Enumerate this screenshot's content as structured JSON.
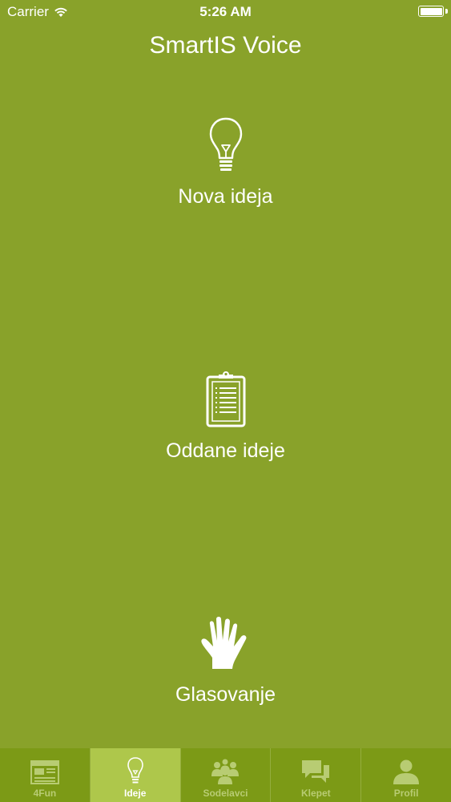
{
  "status_bar": {
    "carrier": "Carrier",
    "time": "5:26 AM"
  },
  "header": {
    "title": "SmartIS Voice"
  },
  "menu": [
    {
      "label": "Nova ideja",
      "icon": "lightbulb-icon"
    },
    {
      "label": "Oddane ideje",
      "icon": "clipboard-icon"
    },
    {
      "label": "Glasovanje",
      "icon": "hand-icon"
    }
  ],
  "tabs": [
    {
      "label": "4Fun",
      "icon": "newspaper-icon",
      "active": false
    },
    {
      "label": "Ideje",
      "icon": "lightbulb-icon",
      "active": true
    },
    {
      "label": "Sodelavci",
      "icon": "people-icon",
      "active": false
    },
    {
      "label": "Klepet",
      "icon": "chat-bubbles-icon",
      "active": false
    },
    {
      "label": "Profil",
      "icon": "person-icon",
      "active": false
    }
  ],
  "colors": {
    "background": "#89a22a",
    "tab_bar": "#7c9a16",
    "tab_active": "#aec74b",
    "tab_inactive_text": "#b8cc73"
  }
}
